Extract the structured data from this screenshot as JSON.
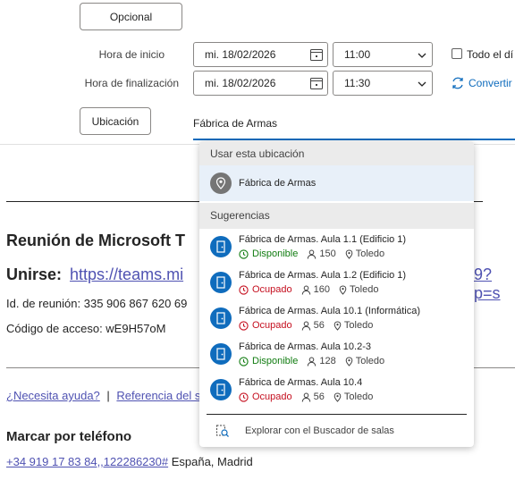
{
  "optional_button": "Opcional",
  "labels": {
    "start": "Hora de inicio",
    "end": "Hora de finalización"
  },
  "start": {
    "date": "mi. 18/02/2026",
    "time": "11:00"
  },
  "end": {
    "date": "mi. 18/02/2026",
    "time": "11:30"
  },
  "all_day_label": "Todo el dí",
  "convert_label": "Convertir",
  "location_button": "Ubicación",
  "location_value": "Fábrica de Armas",
  "body": {
    "title_partial": "Reunión de Microsoft T",
    "join_label": "Unirse:",
    "join_link_left": "https://teams.mi",
    "join_link_right": "9?p=s",
    "meeting_id": "Id. de reunión: 335 906 867 620 69",
    "access_code": "Código de acceso: wE9H57oM",
    "help_link": "¿Necesita ayuda?",
    "separator": "|",
    "reference_link": "Referencia del s",
    "dial_heading": "Marcar por teléfono",
    "phone_link": "+34 919 17 83 84,,122286230#",
    "phone_location": " España, Madrid"
  },
  "dropdown": {
    "use_location_header": "Usar esta ubicación",
    "current_location": "Fábrica de Armas",
    "suggestions_header": "Sugerencias",
    "rooms": [
      {
        "name": "Fábrica de Armas. Aula 1.1 (Edificio 1)",
        "status": "Disponible",
        "status_type": "available",
        "capacity": "150",
        "city": "Toledo"
      },
      {
        "name": "Fábrica de Armas. Aula 1.2 (Edificio 1)",
        "status": "Ocupado",
        "status_type": "busy",
        "capacity": "160",
        "city": "Toledo"
      },
      {
        "name": "Fábrica de Armas. Aula 10.1 (Informática)",
        "status": "Ocupado",
        "status_type": "busy",
        "capacity": "56",
        "city": "Toledo"
      },
      {
        "name": "Fábrica de Armas. Aula 10.2-3",
        "status": "Disponible",
        "status_type": "available",
        "capacity": "128",
        "city": "Toledo"
      },
      {
        "name": "Fábrica de Armas. Aula 10.4",
        "status": "Ocupado",
        "status_type": "busy",
        "capacity": "56",
        "city": "Toledo"
      }
    ],
    "footer": "Explorar con el Buscador de salas"
  },
  "colors": {
    "accent": "#0f6cbd",
    "available": "#107c10",
    "busy": "#c50f1f",
    "link": "#4f52b2"
  }
}
